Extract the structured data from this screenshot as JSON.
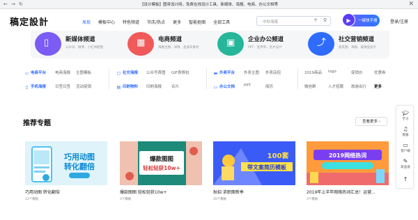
{
  "browser": {
    "back": "←",
    "forward": "→",
    "reload": "↻",
    "title": "【设计模板】图帝设计网，免费在线设计工具、新媒体、海报、电商、办公文档等",
    "close": "✕"
  },
  "header": {
    "logo": "稿定設計",
    "nav": [
      "发现",
      "模板中心",
      "特色频道",
      "节庆/热点",
      "更多",
      "智能抠图",
      "全部工具"
    ],
    "search_placeholder": "中秋海报",
    "one_click_label": "一键快手搜",
    "login_label": "登录/注册"
  },
  "channels": [
    {
      "name": "新媒体频道",
      "desc": "公众号、微博、小红书配图",
      "color": "#7b5cf5",
      "icon": "phone-icon"
    },
    {
      "name": "电商频道",
      "desc": "海报主图、详情、直通车素材",
      "color": "#f05a5a",
      "icon": "shop-icon"
    },
    {
      "name": "企业办公频道",
      "desc": "PPT、宣传单、名片设计",
      "color": "#26b69a",
      "icon": "briefcase-icon"
    },
    {
      "name": "社交营销频道",
      "desc": "朋友圈、海报、邀请函设计",
      "color": "#2f6bff",
      "icon": "share-icon"
    }
  ],
  "categories": {
    "row1": {
      "电商平台": [
        "电商海报",
        "主图模板"
      ],
      "社交海报": [
        "公众号首图",
        "GIF表情包"
      ],
      "外卖平台": [
        "外卖主图",
        "外卖店招"
      ],
      "extra": [
        "2019商品",
        "logo",
        "促销价",
        "优惠券"
      ]
    },
    "row2": {
      "手机海报": [
        "日签日签",
        "活动促销"
      ],
      "印刷物料": [
        "印刷海报",
        "名片"
      ],
      "办公文档": [
        "PPT",
        "简历"
      ],
      "extra": [
        "微信群",
        "入才招聘",
        "旅游出行",
        "更多"
      ]
    }
  },
  "topics": {
    "title": "推荐专题",
    "more": "查看更多 ›",
    "cards": [
      {
        "title": "巧用动图 转化翻倍",
        "count": "12个模板",
        "art": "巧用动图 转化翻倍"
      },
      {
        "title": "爆款图图 轻松轻获10w+",
        "count": "3个模板",
        "art": "爆款图图 轻松轻获10w+"
      },
      {
        "title": "秋招·求职面新季",
        "count": "20个模板",
        "art": "100套 带文案简历模板"
      },
      {
        "title": "2019年上半年网络热词汇总！运营...",
        "count": "3个模板",
        "art": "2019网络热词"
      }
    ]
  },
  "sidebar": {
    "items": [
      "学习",
      "客服",
      "客户端",
      "新品速"
    ],
    "top": "↑"
  }
}
